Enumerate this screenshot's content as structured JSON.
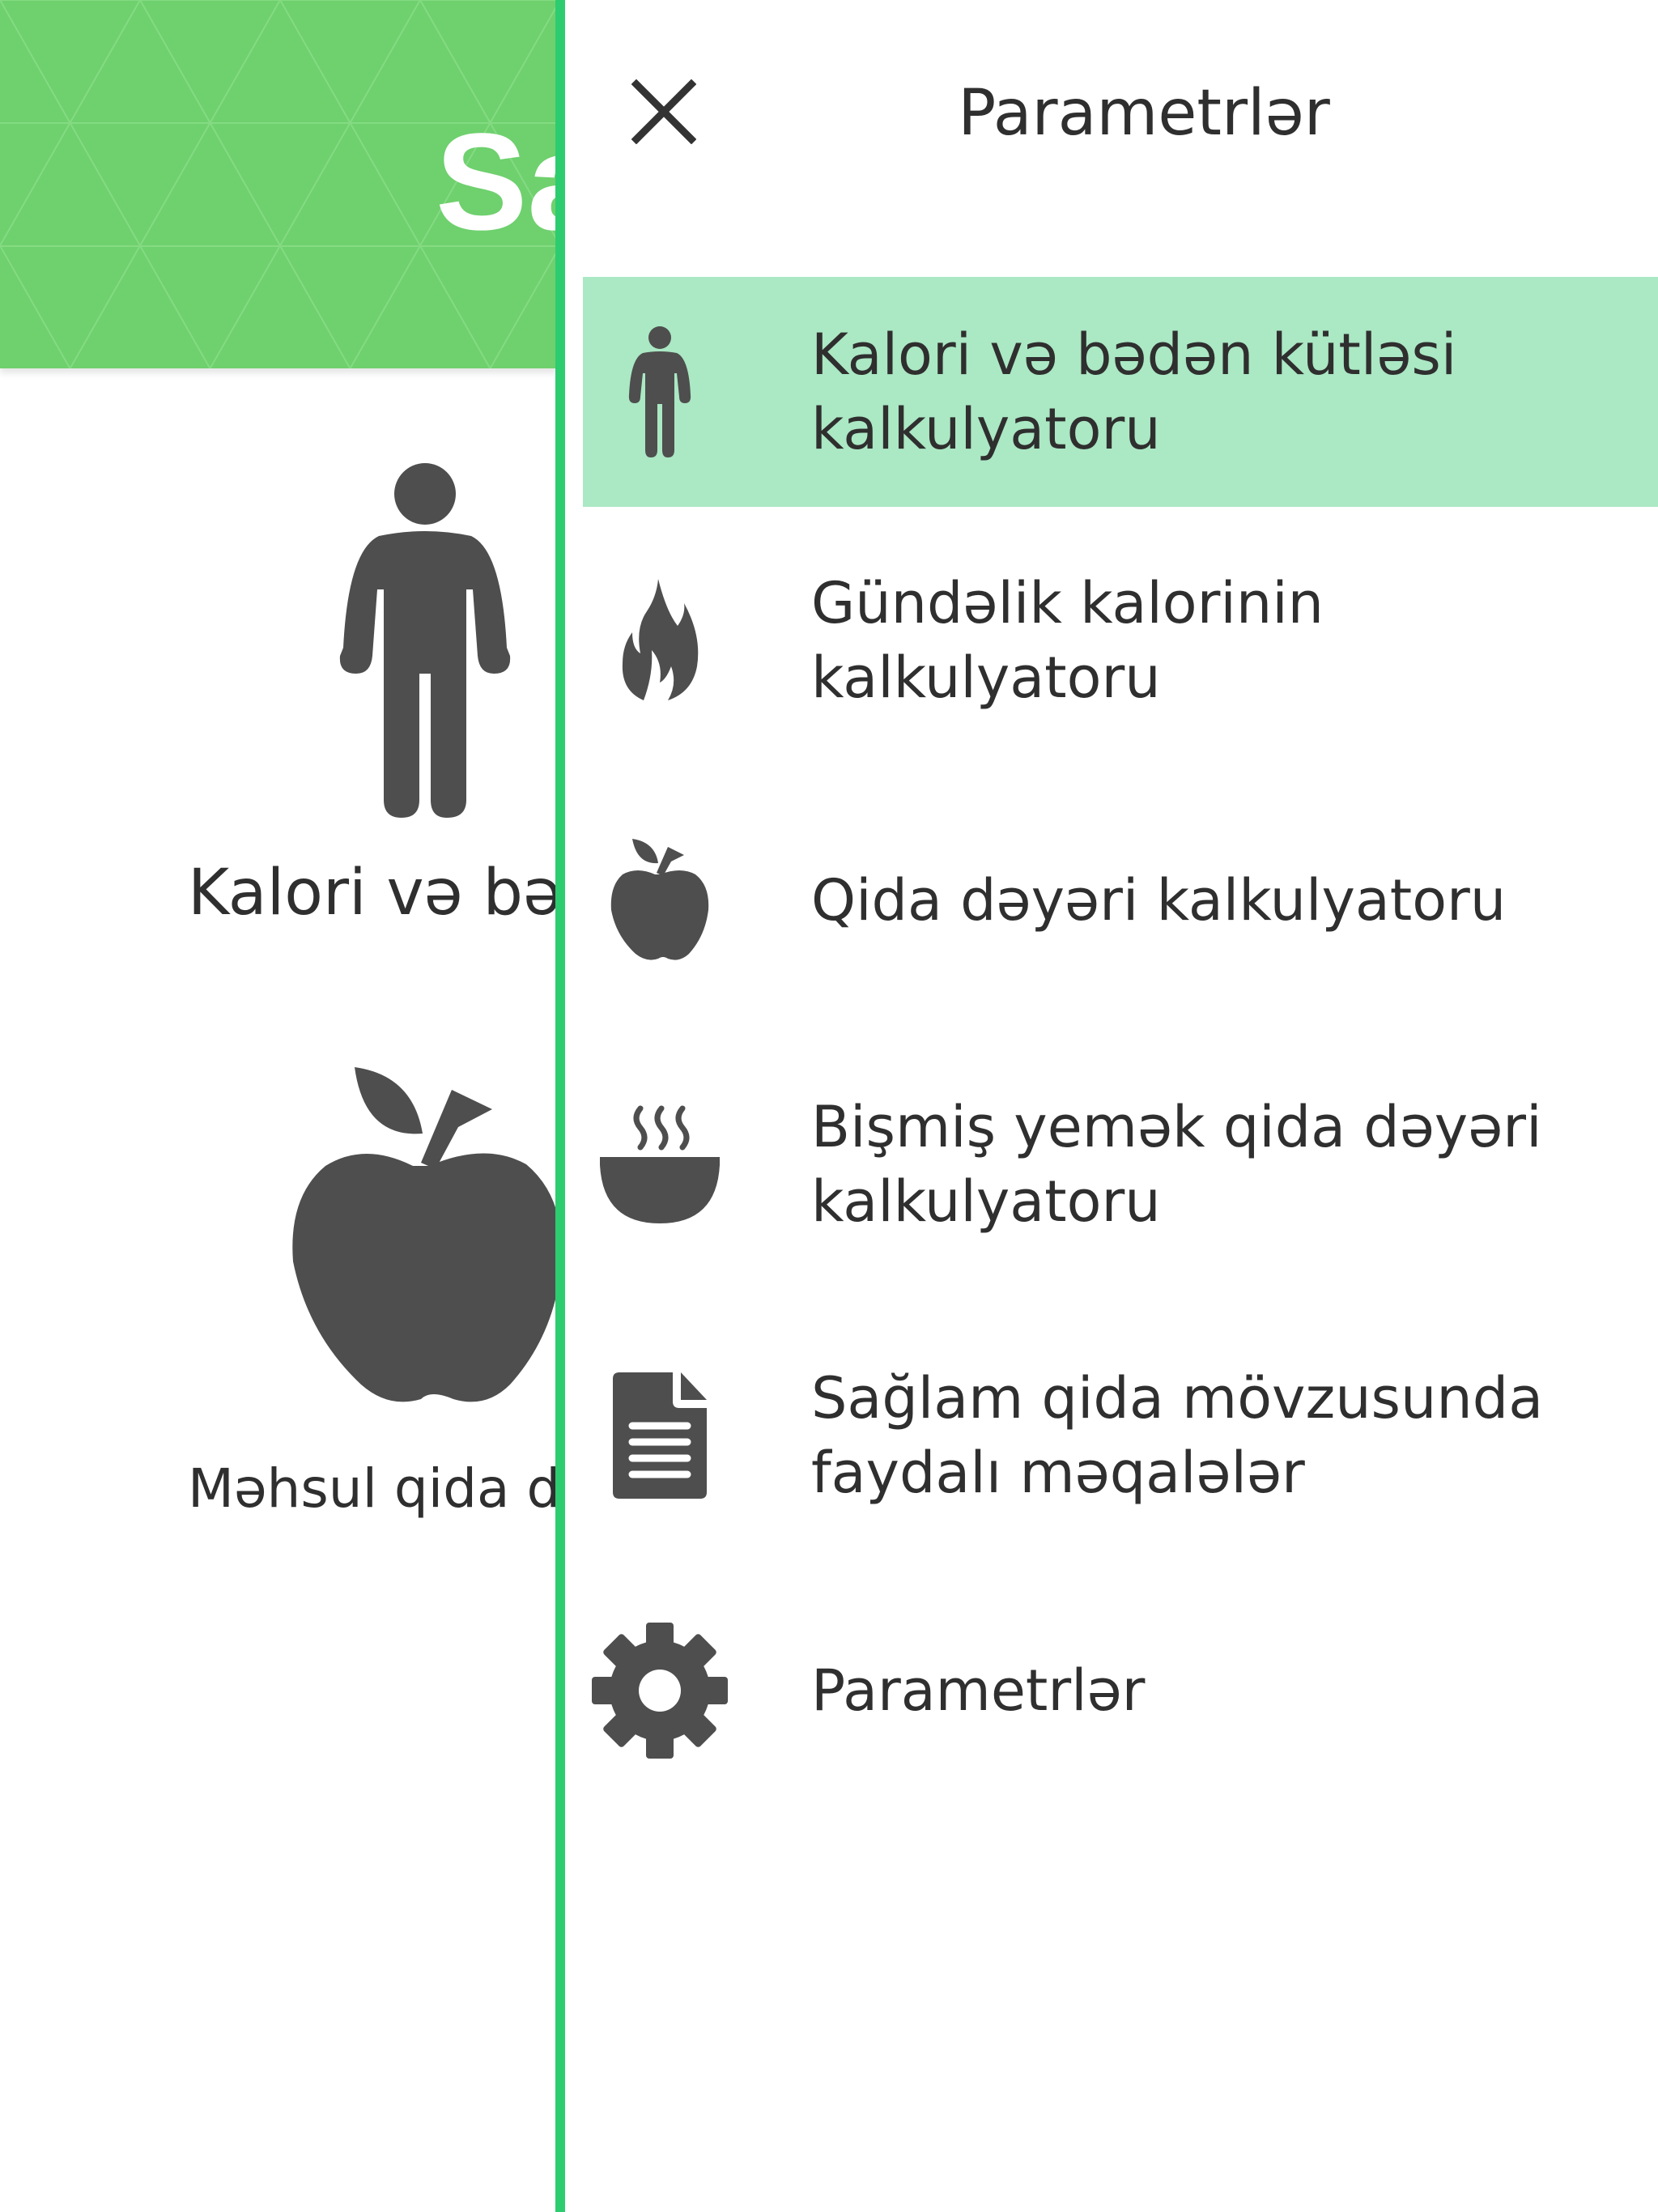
{
  "background": {
    "header_title": "Sa",
    "cards": [
      {
        "icon": "person-icon",
        "label": "Kalori və bəd"
      },
      {
        "icon": "apple-icon",
        "label": "Məhsul qida də"
      }
    ],
    "colors": {
      "header": "#6fd06e"
    }
  },
  "drawer": {
    "title": "Parametrlər",
    "close_icon": "close-icon",
    "items": [
      {
        "icon": "person-icon",
        "label": "Kalori və bədən kütləsi\nkalkulyatoru",
        "active": true
      },
      {
        "icon": "flame-icon",
        "label": "Gündəlik kalorinin\nkalkulyatoru",
        "active": false
      },
      {
        "icon": "apple-icon",
        "label": "Qida dəyəri kalkulyatoru",
        "active": false
      },
      {
        "icon": "hot-bowl-icon",
        "label": "Bişmiş yemək qida dəyəri\nkalkulyatoru",
        "active": false
      },
      {
        "icon": "document-icon",
        "label": "Sağlam qida mövzusunda\nfaydalı məqalələr",
        "active": false
      },
      {
        "icon": "gear-icon",
        "label": "Parametrlər",
        "active": false
      }
    ],
    "colors": {
      "border": "#2ecc71",
      "active_bg": "#abe8c4",
      "icon": "#4e4e4e"
    }
  }
}
